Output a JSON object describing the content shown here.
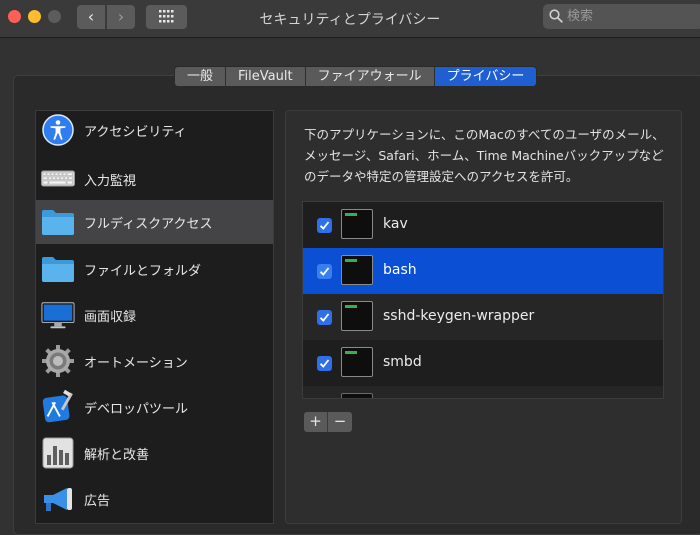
{
  "window": {
    "title": "セキュリティとプライバシー",
    "back_glyph": "‹",
    "forward_glyph": "›"
  },
  "search": {
    "placeholder": "検索",
    "value": ""
  },
  "tabs": [
    {
      "label": "一般",
      "active": false
    },
    {
      "label": "FileVault",
      "active": false
    },
    {
      "label": "ファイアウォール",
      "active": false
    },
    {
      "label": "プライバシー",
      "active": true
    }
  ],
  "sidebar": {
    "items": [
      {
        "label": "アクセシビリティ",
        "icon": "accessibility-icon",
        "selected": false
      },
      {
        "label": "入力監視",
        "icon": "keyboard-icon",
        "selected": false
      },
      {
        "label": "フルディスクアクセス",
        "icon": "folder-icon",
        "selected": true
      },
      {
        "label": "ファイルとフォルダ",
        "icon": "folder-icon",
        "selected": false
      },
      {
        "label": "画面収録",
        "icon": "display-icon",
        "selected": false
      },
      {
        "label": "オートメーション",
        "icon": "gear-icon",
        "selected": false
      },
      {
        "label": "デベロッパツール",
        "icon": "xcode-icon",
        "selected": false
      },
      {
        "label": "解析と改善",
        "icon": "analytics-icon",
        "selected": false
      },
      {
        "label": "広告",
        "icon": "megaphone-icon",
        "selected": false
      }
    ]
  },
  "main": {
    "description": "下のアプリケーションに、このMacのすべてのユーザのメール、メッセージ、Safari、ホーム、Time Machineバックアップなどのデータや特定の管理設定へのアクセスを許可。",
    "apps": [
      {
        "name": "kav",
        "checked": true,
        "selected": false,
        "icon": "terminal-icon"
      },
      {
        "name": "bash",
        "checked": true,
        "selected": true,
        "icon": "terminal-icon"
      },
      {
        "name": "sshd-keygen-wrapper",
        "checked": true,
        "selected": false,
        "icon": "terminal-icon"
      },
      {
        "name": "smbd",
        "checked": true,
        "selected": false,
        "icon": "terminal-icon"
      }
    ],
    "add_label": "+",
    "remove_label": "−"
  },
  "colors": {
    "accent": "#1f5fd1",
    "selection": "#0b4fd4",
    "close": "#fe5f57",
    "minimize": "#febc2e"
  }
}
